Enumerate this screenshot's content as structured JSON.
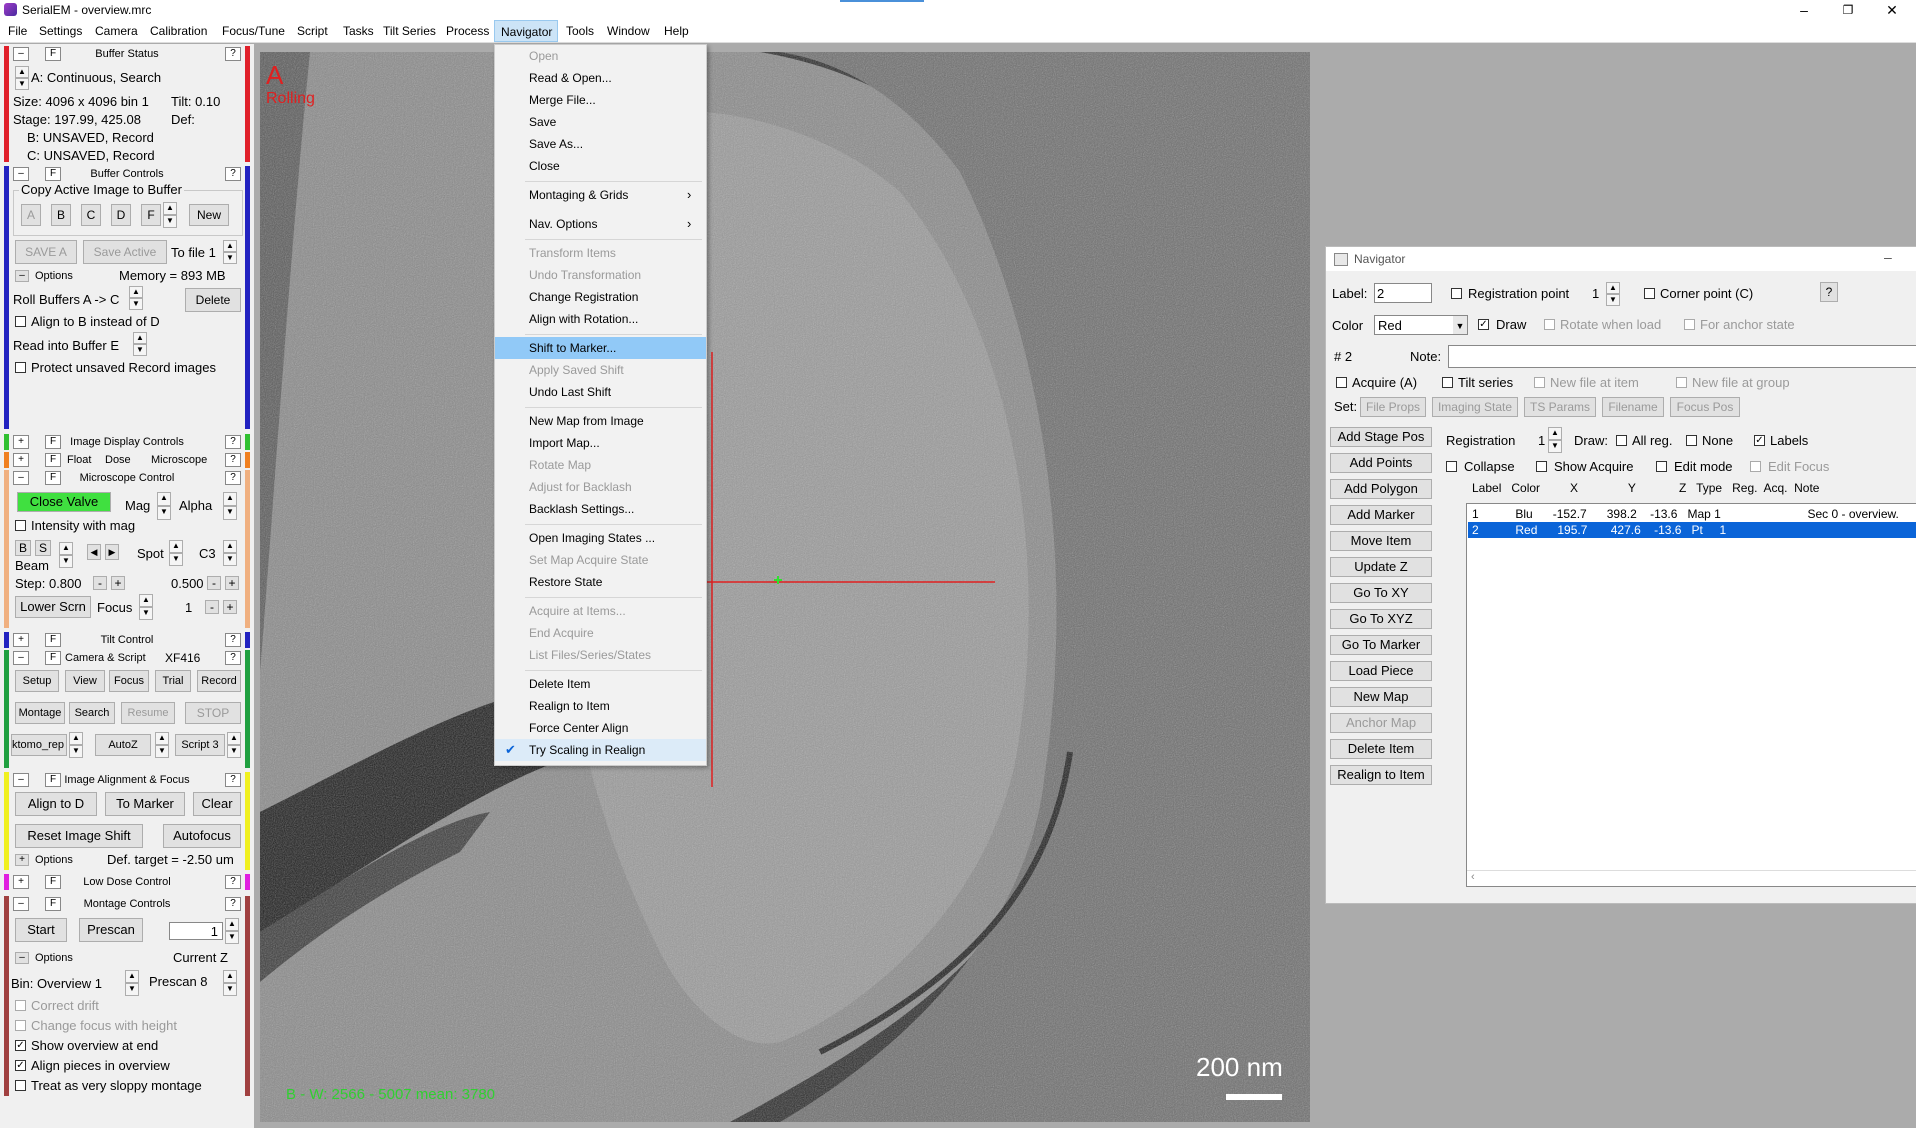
{
  "app": {
    "title": "SerialEM  -  overview.mrc"
  },
  "menubar": [
    "File",
    "Settings",
    "Camera",
    "Calibration",
    "Focus/Tune",
    "Script",
    "Tasks",
    "Tilt Series",
    "Process",
    "Navigator",
    "Tools",
    "Window",
    "Help"
  ],
  "buffer_status": {
    "title": "Buffer Status",
    "line1": "A: Continuous, Search",
    "size": "Size: 4096 x 4096  bin 1",
    "tilt": "Tilt: 0.10",
    "stage": "Stage: 197.99, 425.08",
    "def": "Def:",
    "b": "B: UNSAVED, Record",
    "c": "C: UNSAVED, Record"
  },
  "buffer_controls": {
    "title": "Buffer Controls",
    "group": "Copy Active Image to Buffer",
    "buttons": [
      "A",
      "B",
      "C",
      "D",
      "F"
    ],
    "new": "New",
    "save_a": "SAVE A",
    "save_active": "Save Active",
    "to_file": "To file 1",
    "options": "Options",
    "memory": "Memory = 893 MB",
    "roll": "Roll Buffers A ->   C",
    "delete": "Delete",
    "align_b": "Align to B instead of D",
    "read_into": "Read into Buffer    E",
    "protect": "Protect unsaved Record images"
  },
  "image_display": {
    "title": "Image Display Controls"
  },
  "float_row": {
    "float": "Float",
    "dose": "Dose",
    "microscope": "Microscope"
  },
  "microscope": {
    "title": "Microscope Control",
    "close_valve": "Close Valve",
    "mag": "Mag",
    "alpha": "Alpha",
    "intensity": "Intensity with mag",
    "b": "B",
    "s": "S",
    "beam": "Beam",
    "spot": "Spot",
    "c3": "C3",
    "step": "Step:  0.800",
    "step2": "0.500",
    "lower": "Lower Scrn",
    "focus": "Focus",
    "one": "1"
  },
  "tilt_control": {
    "title": "Tilt Control"
  },
  "camera_script": {
    "title": "Camera & Script",
    "camera": "XF416",
    "buttons": [
      "Setup",
      "View",
      "Focus",
      "Trial",
      "Record",
      "Montage",
      "Search",
      "Resume",
      "STOP"
    ],
    "script1": "ktomo_rep",
    "autoz": "AutoZ",
    "script3": "Script 3"
  },
  "alignment": {
    "title": "Image Alignment & Focus",
    "align_d": "Align to D",
    "to_marker": "To Marker",
    "clear": "Clear",
    "reset_shift": "Reset Image Shift",
    "autofocus": "Autofocus",
    "options": "Options",
    "def_target": "Def. target = -2.50 um"
  },
  "low_dose": {
    "title": "Low Dose Control"
  },
  "montage": {
    "title": "Montage Controls",
    "start": "Start",
    "prescan": "Prescan",
    "value": "1",
    "options": "Options",
    "current_z": "Current Z",
    "bin": "Bin: Overview 1",
    "prescan8": "Prescan 8",
    "correct_drift": "Correct drift",
    "change_focus": "Change focus with height",
    "show_overview": "Show overview at end",
    "align_pieces": "Align pieces in overview",
    "sloppy": "Treat as very sloppy montage"
  },
  "image": {
    "buffer_letter": "A",
    "rolling": "Rolling",
    "scale": "200 nm",
    "status": "B - W: 2566 - 5007  mean: 3780"
  },
  "nav_menu": {
    "items": [
      {
        "label": "Open",
        "enabled": false
      },
      {
        "label": "Read & Open...",
        "enabled": true
      },
      {
        "label": "Merge File...",
        "enabled": true
      },
      {
        "label": "Save",
        "enabled": true
      },
      {
        "label": "Save As...",
        "enabled": true
      },
      {
        "label": "Close",
        "enabled": true
      },
      {
        "label": "Montaging & Grids",
        "enabled": true,
        "submenu": true
      },
      {
        "label": "Nav. Options",
        "enabled": true,
        "submenu": true
      },
      {
        "label": "Transform Items",
        "enabled": false
      },
      {
        "label": "Undo Transformation",
        "enabled": false
      },
      {
        "label": "Change Registration",
        "enabled": true
      },
      {
        "label": "Align with Rotation...",
        "enabled": true
      },
      {
        "label": "Shift to Marker...",
        "enabled": true,
        "highlight": true
      },
      {
        "label": "Apply Saved Shift",
        "enabled": false
      },
      {
        "label": "Undo Last Shift",
        "enabled": true
      },
      {
        "label": "New Map from Image",
        "enabled": true
      },
      {
        "label": "Import Map...",
        "enabled": true
      },
      {
        "label": "Rotate Map",
        "enabled": false
      },
      {
        "label": "Adjust for Backlash",
        "enabled": false
      },
      {
        "label": "Backlash Settings...",
        "enabled": true
      },
      {
        "label": "Open Imaging States ...",
        "enabled": true
      },
      {
        "label": "Set Map Acquire State",
        "enabled": false
      },
      {
        "label": "Restore State",
        "enabled": true
      },
      {
        "label": "Acquire at Items...",
        "enabled": false
      },
      {
        "label": "End Acquire",
        "enabled": false
      },
      {
        "label": "List Files/Series/States",
        "enabled": false
      },
      {
        "label": "Delete Item",
        "enabled": true
      },
      {
        "label": "Realign to Item",
        "enabled": true
      },
      {
        "label": "Force Center Align",
        "enabled": true
      },
      {
        "label": "Try Scaling in Realign",
        "enabled": true,
        "checked": true
      }
    ]
  },
  "navigator": {
    "title": "Navigator",
    "label_lbl": "Label:",
    "label_val": "2",
    "registration_point": "Registration point",
    "reg_val": "1",
    "corner_point": "Corner point (C)",
    "help": "?",
    "color_lbl": "Color",
    "color_val": "Red",
    "draw": "Draw",
    "rotate_load": "Rotate when load",
    "anchor_state": "For anchor state",
    "num": "# 2",
    "note_lbl": "Note:",
    "acquire": "Acquire (A)",
    "tilt_series": "Tilt series",
    "new_file_item": "New file at item",
    "new_file_group": "New file at group",
    "set": "Set:",
    "set_buttons": [
      "File Props",
      "Imaging State",
      "TS Params",
      "Filename",
      "Focus Pos"
    ],
    "side_buttons": [
      {
        "label": "Add Stage Pos",
        "enabled": true
      },
      {
        "label": "Add Points",
        "enabled": true
      },
      {
        "label": "Add Polygon",
        "enabled": true
      },
      {
        "label": "Add Marker",
        "enabled": true
      },
      {
        "label": "Move Item",
        "enabled": true
      },
      {
        "label": "Update Z",
        "enabled": true
      },
      {
        "label": "Go To XY",
        "enabled": true
      },
      {
        "label": "Go To XYZ",
        "enabled": true
      },
      {
        "label": "Go To Marker",
        "enabled": true
      },
      {
        "label": "Load Piece",
        "enabled": true
      },
      {
        "label": "New Map",
        "enabled": true
      },
      {
        "label": "Anchor Map",
        "enabled": false
      },
      {
        "label": "Delete Item",
        "enabled": true
      },
      {
        "label": "Realign to Item",
        "enabled": true
      }
    ],
    "registration": "Registration",
    "registration_val": "1",
    "draw_lbl": "Draw:",
    "all_reg": "All reg.",
    "none": "None",
    "labels": "Labels",
    "collapse": "Collapse",
    "show_acquire": "Show Acquire",
    "edit_mode": "Edit mode",
    "edit_focus": "Edit Focus",
    "columns": "Label   Color         X               Y             Z   Type   Reg.  Acq.  Note",
    "rows": [
      {
        "text": "1           Blu      -152.7      398.2    -13.6   Map 1                          Sec 0 - overview.",
        "selected": false
      },
      {
        "text": "2           Red      195.7       427.6    -13.6   Pt     1",
        "selected": true
      }
    ]
  }
}
